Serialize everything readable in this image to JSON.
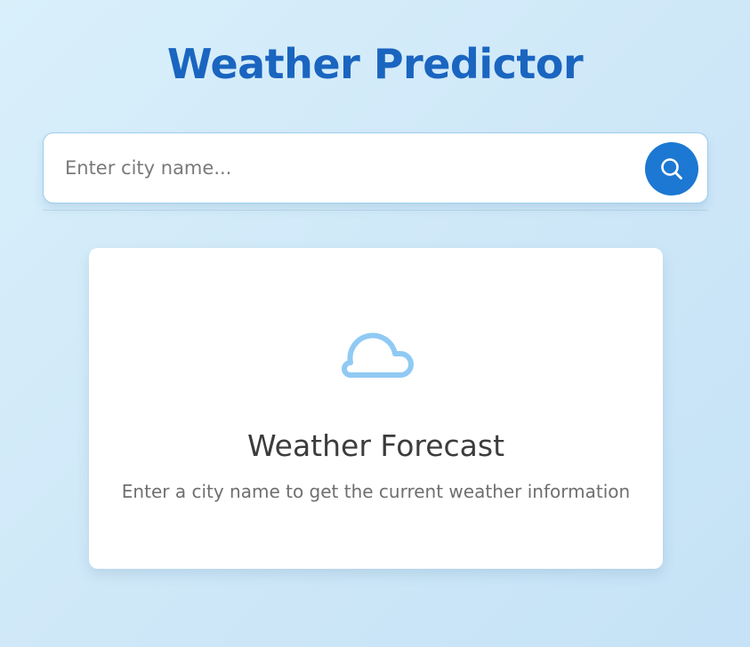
{
  "app": {
    "title": "Weather Predictor"
  },
  "search": {
    "placeholder": "Enter city name...",
    "value": "",
    "button_icon": "search-icon",
    "button_color": "#1c78d2"
  },
  "card": {
    "icon": "cloud-icon",
    "icon_color": "#90caf4",
    "title": "Weather Forecast",
    "description": "Enter a city name to get the current weather information"
  },
  "colors": {
    "title": "#1a65c0",
    "accent": "#1c78d2"
  }
}
